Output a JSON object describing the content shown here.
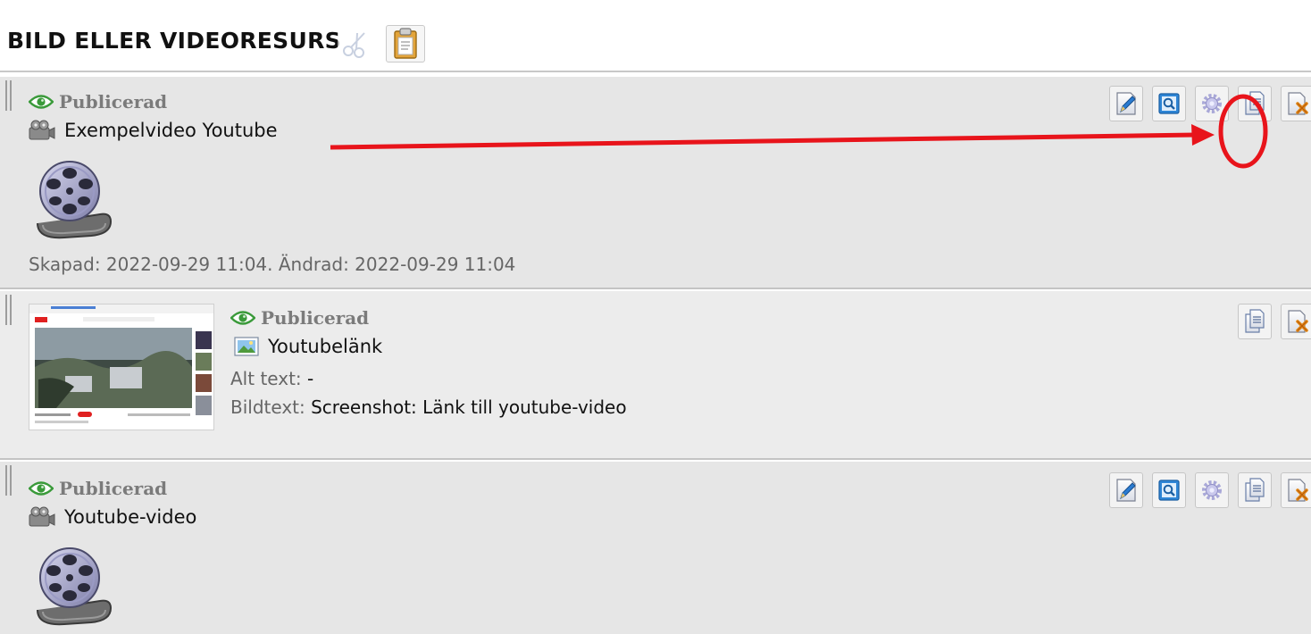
{
  "header": {
    "title": "BILD ELLER VIDEORESURS"
  },
  "resources": [
    {
      "status": "Publicerad",
      "title": "Exempelvideo Youtube",
      "type_icon": "film-icon",
      "created_line": "Skapad: 2022-09-29 11:04. Ändrad: 2022-09-29 11:04",
      "actions": [
        "edit-icon",
        "preview-icon",
        "settings-icon",
        "copy-icon",
        "delete-icon"
      ]
    },
    {
      "status": "Publicerad",
      "title": "Youtubelänk",
      "type_icon": "image-icon",
      "alt_label": "Alt text:",
      "alt_value": "-",
      "caption_label": "Bildtext:",
      "caption_value": "Screenshot: Länk till youtube-video",
      "actions": [
        "copy-icon",
        "delete-icon"
      ]
    },
    {
      "status": "Publicerad",
      "title": "Youtube-video",
      "type_icon": "film-icon",
      "actions": [
        "edit-icon",
        "preview-icon",
        "settings-icon",
        "copy-icon",
        "delete-icon"
      ]
    }
  ],
  "annotation": {
    "color": "#e8141b",
    "target": "copy-button"
  },
  "colors": {
    "status_eye": "#3a9a3a",
    "block_bg": "#e6e6e6",
    "accent_blue": "#2a7bd1"
  }
}
